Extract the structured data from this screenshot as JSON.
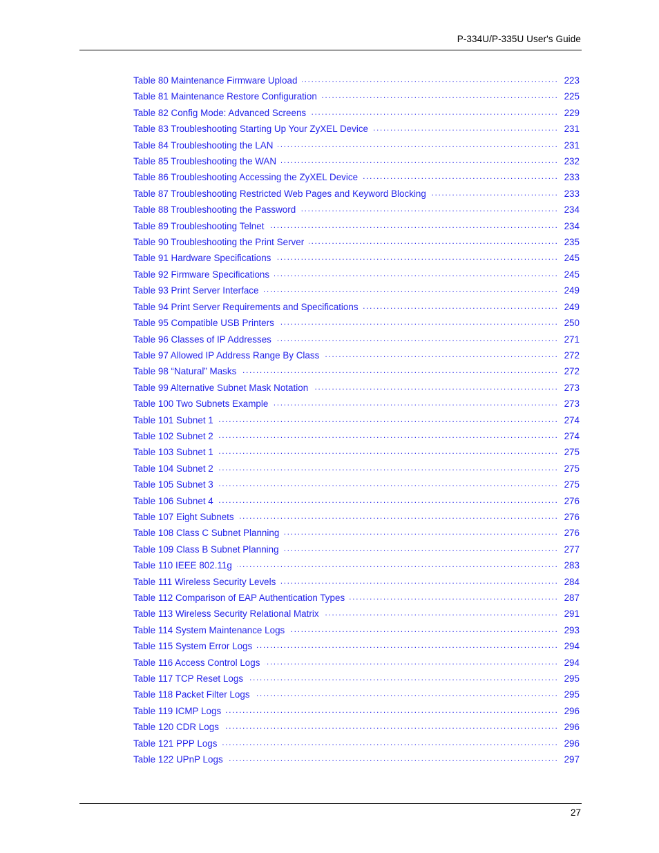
{
  "document": {
    "header_title": "P-334U/P-335U User's Guide",
    "page_number": "27",
    "text_color": "#2323ea",
    "rule_color": "#000000"
  },
  "toc": {
    "entries": [
      {
        "label": "Table 80 Maintenance Firmware Upload",
        "page": "223"
      },
      {
        "label": "Table 81 Maintenance Restore Configuration",
        "page": "225"
      },
      {
        "label": "Table 82 Config Mode: Advanced Screens",
        "page": "229"
      },
      {
        "label": "Table 83 Troubleshooting Starting Up Your ZyXEL Device",
        "page": "231"
      },
      {
        "label": "Table 84 Troubleshooting the LAN",
        "page": "231"
      },
      {
        "label": "Table 85 Troubleshooting the WAN",
        "page": "232"
      },
      {
        "label": "Table 86 Troubleshooting Accessing the ZyXEL Device",
        "page": "233"
      },
      {
        "label": "Table 87 Troubleshooting Restricted Web Pages and Keyword Blocking",
        "page": "233"
      },
      {
        "label": "Table 88 Troubleshooting the Password",
        "page": "234"
      },
      {
        "label": "Table 89 Troubleshooting Telnet",
        "page": "234"
      },
      {
        "label": "Table 90 Troubleshooting the Print Server",
        "page": "235"
      },
      {
        "label": "Table 91 Hardware Specifications",
        "page": "245"
      },
      {
        "label": "Table 92 Firmware Specifications",
        "page": "245"
      },
      {
        "label": "Table 93 Print Server Interface",
        "page": "249"
      },
      {
        "label": "Table 94 Print Server Requirements and Specifications",
        "page": "249"
      },
      {
        "label": "Table 95 Compatible USB Printers",
        "page": "250"
      },
      {
        "label": "Table 96 Classes of IP Addresses",
        "page": "271"
      },
      {
        "label": "Table 97 Allowed IP Address Range By Class",
        "page": "272"
      },
      {
        "label": "Table 98  “Natural” Masks",
        "page": "272"
      },
      {
        "label": "Table 99 Alternative Subnet Mask Notation",
        "page": "273"
      },
      {
        "label": "Table 100 Two Subnets Example",
        "page": "273"
      },
      {
        "label": "Table 101 Subnet 1",
        "page": "274"
      },
      {
        "label": "Table 102 Subnet 2",
        "page": "274"
      },
      {
        "label": "Table 103 Subnet 1",
        "page": "275"
      },
      {
        "label": "Table 104 Subnet 2",
        "page": "275"
      },
      {
        "label": "Table 105 Subnet 3",
        "page": "275"
      },
      {
        "label": "Table 106 Subnet 4",
        "page": "276"
      },
      {
        "label": "Table 107 Eight Subnets",
        "page": "276"
      },
      {
        "label": "Table 108 Class C Subnet Planning",
        "page": "276"
      },
      {
        "label": "Table 109 Class B Subnet Planning",
        "page": "277"
      },
      {
        "label": "Table 110 IEEE 802.11g",
        "page": "283"
      },
      {
        "label": "Table 111 Wireless Security Levels",
        "page": "284"
      },
      {
        "label": "Table 112 Comparison of EAP Authentication Types",
        "page": "287"
      },
      {
        "label": "Table 113 Wireless Security Relational Matrix",
        "page": "291"
      },
      {
        "label": "Table 114 System Maintenance Logs",
        "page": "293"
      },
      {
        "label": "Table 115 System Error Logs",
        "page": "294"
      },
      {
        "label": "Table 116 Access Control Logs",
        "page": "294"
      },
      {
        "label": "Table 117 TCP Reset Logs",
        "page": "295"
      },
      {
        "label": "Table 118 Packet Filter Logs",
        "page": "295"
      },
      {
        "label": "Table 119 ICMP Logs",
        "page": "296"
      },
      {
        "label": "Table 120 CDR Logs",
        "page": "296"
      },
      {
        "label": "Table 121 PPP Logs",
        "page": "296"
      },
      {
        "label": "Table 122 UPnP Logs",
        "page": "297"
      }
    ]
  }
}
